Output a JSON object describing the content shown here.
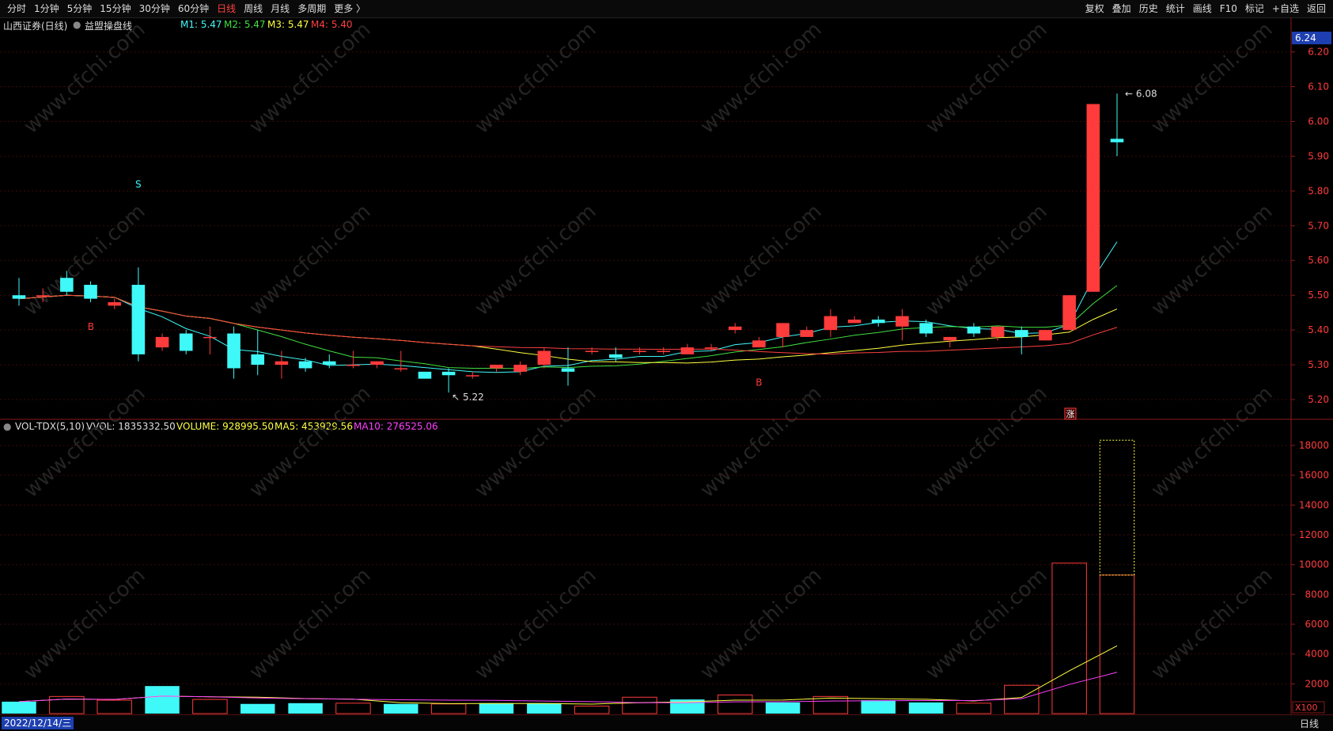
{
  "toolbar": {
    "periods": [
      "分时",
      "1分钟",
      "5分钟",
      "15分钟",
      "30分钟",
      "60分钟",
      "日线",
      "周线",
      "月线",
      "多周期",
      "更多 〉"
    ],
    "active_period": "日线",
    "right_items": [
      "复权",
      "叠加",
      "历史",
      "统计",
      "画线",
      "F10",
      "标记",
      "+自选",
      "返回"
    ]
  },
  "info": {
    "stock": "山西证券(日线)",
    "indicator": "益盟操盘线",
    "m1": "M1: 5.47",
    "m2": "M2: 5.47",
    "m3": "M3: 5.47",
    "m4": "M4: 5.40"
  },
  "volume_info": {
    "name": "VOL-TDX(5,10)",
    "vvol": "VVOL: 1835332.50",
    "volume": "VOLUME: 928995.50",
    "ma5": "MA5: 453929.56",
    "ma10": "MA10: 276525.06"
  },
  "price_axis": {
    "current": "6.24",
    "ticks": [
      "6.20",
      "6.10",
      "6.00",
      "5.90",
      "5.80",
      "5.70",
      "5.60",
      "5.50",
      "5.40",
      "5.30",
      "5.20"
    ]
  },
  "volume_axis": {
    "ticks": [
      "18000",
      "16000",
      "14000",
      "12000",
      "10000",
      "8000",
      "6000",
      "4000",
      "2000"
    ],
    "unit": "X100"
  },
  "annotations": {
    "high": "6.08",
    "low": "5.22",
    "s_mark": "S",
    "b_mark": "B",
    "zhang": "涨"
  },
  "footer": {
    "date": "2022/12/14/三",
    "period": "日线"
  },
  "watermark": "www.cfchi.com",
  "colors": {
    "up": "#ff3b3b",
    "down": "#3ff8f8",
    "m1": "#3ff8f8",
    "m2": "#40e040",
    "m3": "#ffff40",
    "m4": "#ff4040",
    "ma10": "#ff40ff"
  },
  "chart_data": {
    "type": "candlestick",
    "title": "山西证券(日线)",
    "candles": [
      {
        "o": 5.5,
        "c": 5.49,
        "h": 5.55,
        "l": 5.47
      },
      {
        "o": 5.5,
        "c": 5.5,
        "h": 5.52,
        "l": 5.48
      },
      {
        "o": 5.55,
        "c": 5.51,
        "h": 5.57,
        "l": 5.5
      },
      {
        "o": 5.53,
        "c": 5.49,
        "h": 5.54,
        "l": 5.48
      },
      {
        "o": 5.47,
        "c": 5.48,
        "h": 5.49,
        "l": 5.46
      },
      {
        "o": 5.53,
        "c": 5.33,
        "h": 5.58,
        "l": 5.31
      },
      {
        "o": 5.35,
        "c": 5.38,
        "h": 5.39,
        "l": 5.34
      },
      {
        "o": 5.39,
        "c": 5.34,
        "h": 5.4,
        "l": 5.33
      },
      {
        "o": 5.38,
        "c": 5.38,
        "h": 5.41,
        "l": 5.33
      },
      {
        "o": 5.39,
        "c": 5.29,
        "h": 5.41,
        "l": 5.26
      },
      {
        "o": 5.33,
        "c": 5.3,
        "h": 5.4,
        "l": 5.27
      },
      {
        "o": 5.3,
        "c": 5.31,
        "h": 5.34,
        "l": 5.26
      },
      {
        "o": 5.31,
        "c": 5.29,
        "h": 5.32,
        "l": 5.28
      },
      {
        "o": 5.31,
        "c": 5.3,
        "h": 5.33,
        "l": 5.29
      },
      {
        "o": 5.3,
        "c": 5.3,
        "h": 5.34,
        "l": 5.29
      },
      {
        "o": 5.3,
        "c": 5.31,
        "h": 5.31,
        "l": 5.29
      },
      {
        "o": 5.29,
        "c": 5.29,
        "h": 5.34,
        "l": 5.28
      },
      {
        "o": 5.28,
        "c": 5.26,
        "h": 5.28,
        "l": 5.26
      },
      {
        "o": 5.28,
        "c": 5.27,
        "h": 5.29,
        "l": 5.22
      },
      {
        "o": 5.27,
        "c": 5.27,
        "h": 5.28,
        "l": 5.26
      },
      {
        "o": 5.29,
        "c": 5.3,
        "h": 5.3,
        "l": 5.28
      },
      {
        "o": 5.28,
        "c": 5.3,
        "h": 5.31,
        "l": 5.27
      },
      {
        "o": 5.3,
        "c": 5.34,
        "h": 5.35,
        "l": 5.29
      },
      {
        "o": 5.29,
        "c": 5.28,
        "h": 5.35,
        "l": 5.24
      },
      {
        "o": 5.34,
        "c": 5.34,
        "h": 5.35,
        "l": 5.33
      },
      {
        "o": 5.33,
        "c": 5.32,
        "h": 5.35,
        "l": 5.31
      },
      {
        "o": 5.34,
        "c": 5.34,
        "h": 5.35,
        "l": 5.33
      },
      {
        "o": 5.34,
        "c": 5.34,
        "h": 5.35,
        "l": 5.33
      },
      {
        "o": 5.33,
        "c": 5.35,
        "h": 5.36,
        "l": 5.33
      },
      {
        "o": 5.35,
        "c": 5.35,
        "h": 5.36,
        "l": 5.34
      },
      {
        "o": 5.4,
        "c": 5.41,
        "h": 5.42,
        "l": 5.39
      },
      {
        "o": 5.35,
        "c": 5.37,
        "h": 5.38,
        "l": 5.35
      },
      {
        "o": 5.38,
        "c": 5.42,
        "h": 5.42,
        "l": 5.35
      },
      {
        "o": 5.38,
        "c": 5.4,
        "h": 5.41,
        "l": 5.38
      },
      {
        "o": 5.4,
        "c": 5.44,
        "h": 5.46,
        "l": 5.38
      },
      {
        "o": 5.42,
        "c": 5.43,
        "h": 5.44,
        "l": 5.42
      },
      {
        "o": 5.43,
        "c": 5.42,
        "h": 5.44,
        "l": 5.41
      },
      {
        "o": 5.41,
        "c": 5.44,
        "h": 5.46,
        "l": 5.37
      },
      {
        "o": 5.42,
        "c": 5.39,
        "h": 5.43,
        "l": 5.38
      },
      {
        "o": 5.37,
        "c": 5.38,
        "h": 5.38,
        "l": 5.35
      },
      {
        "o": 5.41,
        "c": 5.39,
        "h": 5.42,
        "l": 5.38
      },
      {
        "o": 5.38,
        "c": 5.41,
        "h": 5.41,
        "l": 5.37
      },
      {
        "o": 5.4,
        "c": 5.38,
        "h": 5.41,
        "l": 5.33
      },
      {
        "o": 5.37,
        "c": 5.4,
        "h": 5.4,
        "l": 5.37
      },
      {
        "o": 5.4,
        "c": 5.5,
        "h": 5.5,
        "l": 5.4
      },
      {
        "o": 5.51,
        "c": 6.05,
        "h": 6.05,
        "l": 5.51
      },
      {
        "o": 5.95,
        "c": 5.94,
        "h": 6.08,
        "l": 5.9
      }
    ],
    "ylim": [
      5.15,
      6.24
    ],
    "volumes": [
      {
        "v": 800,
        "up": false
      },
      {
        "v": 1150,
        "up": true
      },
      {
        "v": 900,
        "up": true
      },
      {
        "v": 1850,
        "up": false
      },
      {
        "v": 950,
        "up": true
      },
      {
        "v": 650,
        "up": false
      },
      {
        "v": 700,
        "up": false
      },
      {
        "v": 700,
        "up": true
      },
      {
        "v": 650,
        "up": false
      },
      {
        "v": 650,
        "up": true
      },
      {
        "v": 700,
        "up": false
      },
      {
        "v": 700,
        "up": false
      },
      {
        "v": 500,
        "up": true
      },
      {
        "v": 1100,
        "up": true
      },
      {
        "v": 950,
        "up": false
      },
      {
        "v": 1250,
        "up": true
      },
      {
        "v": 750,
        "up": false
      },
      {
        "v": 1150,
        "up": true
      },
      {
        "v": 900,
        "up": false
      },
      {
        "v": 750,
        "up": false
      },
      {
        "v": 700,
        "up": true
      },
      {
        "v": 1900,
        "up": true
      },
      {
        "v": 10100,
        "up": true
      },
      {
        "v": 9300,
        "up": true
      }
    ],
    "vvol_projection": 18353,
    "ylim_volume": [
      0,
      18800
    ]
  }
}
